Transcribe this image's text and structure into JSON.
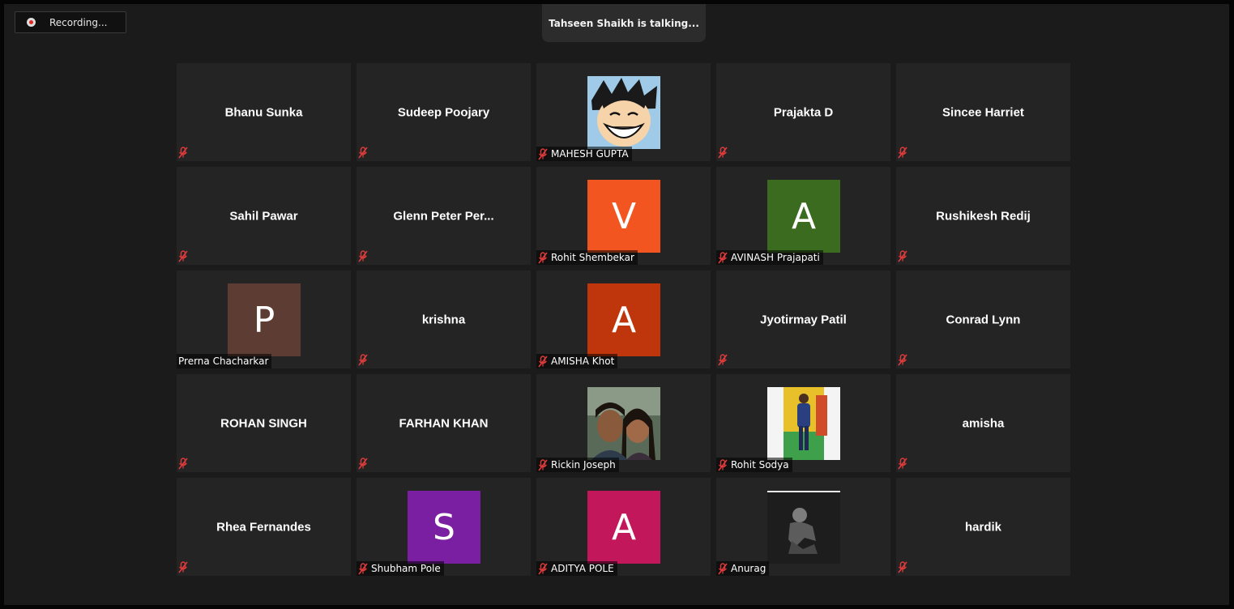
{
  "recording": {
    "label": "Recording..."
  },
  "active_speaker": {
    "text": "Tahseen Shaikh is talking..."
  },
  "participants": [
    {
      "name": "Bhanu Sunka",
      "type": "name",
      "muted": true
    },
    {
      "name": "Sudeep Poojary",
      "type": "name",
      "muted": true
    },
    {
      "name": "MAHESH GUPTA",
      "type": "photo",
      "photo": "cartoon-avatar",
      "muted": true
    },
    {
      "name": "Prajakta D",
      "type": "name",
      "muted": true
    },
    {
      "name": "Sincee Harriet",
      "type": "name",
      "muted": true
    },
    {
      "name": "Sahil Pawar",
      "type": "name",
      "muted": true
    },
    {
      "name": "Glenn Peter Per...",
      "type": "name",
      "muted": true
    },
    {
      "name": "Rohit Shembekar",
      "type": "avatar",
      "letter": "V",
      "color": "#f2551f",
      "muted": true
    },
    {
      "name": "AVINASH Prajapati",
      "type": "avatar",
      "letter": "A",
      "color": "#3a6b1f",
      "muted": true
    },
    {
      "name": "Rushikesh Redij",
      "type": "name",
      "muted": true
    },
    {
      "name": "Prerna Chacharkar",
      "type": "avatar",
      "letter": "P",
      "color": "#5d3d33",
      "muted": false
    },
    {
      "name": "krishna",
      "type": "name",
      "muted": true
    },
    {
      "name": "AMISHA Khot",
      "type": "avatar",
      "letter": "A",
      "color": "#bf360c",
      "muted": true
    },
    {
      "name": "Jyotirmay Patil",
      "type": "name",
      "muted": true
    },
    {
      "name": "Conrad Lynn",
      "type": "name",
      "muted": true
    },
    {
      "name": "ROHAN SINGH",
      "type": "name",
      "muted": true
    },
    {
      "name": "FARHAN KHAN",
      "type": "name",
      "muted": true
    },
    {
      "name": "Rickin Joseph",
      "type": "photo",
      "photo": "couple-selfie",
      "muted": true
    },
    {
      "name": "Rohit Sodya",
      "type": "photo",
      "photo": "standing-person",
      "muted": true
    },
    {
      "name": "amisha",
      "type": "name",
      "muted": true
    },
    {
      "name": "Rhea Fernandes",
      "type": "name",
      "muted": true
    },
    {
      "name": "Shubham Pole",
      "type": "avatar",
      "letter": "S",
      "color": "#7b1fa2",
      "muted": true
    },
    {
      "name": "ADITYA POLE",
      "type": "avatar",
      "letter": "A",
      "color": "#c2185b",
      "muted": true
    },
    {
      "name": "Anurag",
      "type": "photo",
      "photo": "bw-portrait",
      "muted": true
    },
    {
      "name": "hardik",
      "type": "name",
      "muted": true
    }
  ]
}
